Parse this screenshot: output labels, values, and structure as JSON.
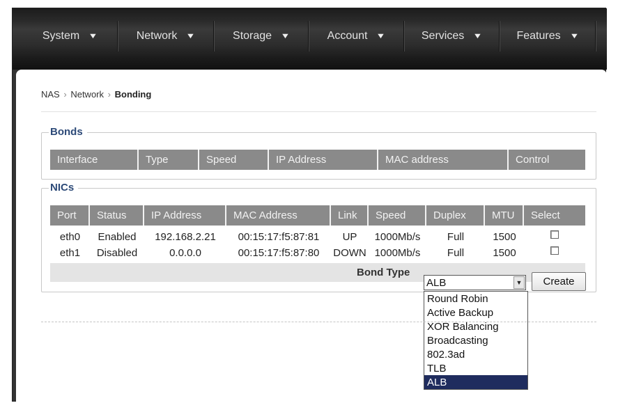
{
  "nav": [
    {
      "label": "System"
    },
    {
      "label": "Network"
    },
    {
      "label": "Storage"
    },
    {
      "label": "Account"
    },
    {
      "label": "Services"
    },
    {
      "label": "Features"
    }
  ],
  "breadcrumb": {
    "root": "NAS",
    "parent": "Network",
    "current": "Bonding",
    "separator": "›"
  },
  "bonds": {
    "legend": "Bonds",
    "headers": [
      "Interface",
      "Type",
      "Speed",
      "IP Address",
      "MAC address",
      "Control"
    ]
  },
  "nics": {
    "legend": "NICs",
    "headers": [
      "Port",
      "Status",
      "IP Address",
      "MAC Address",
      "Link",
      "Speed",
      "Duplex",
      "MTU",
      "Select"
    ],
    "rows": [
      {
        "port": "eth0",
        "status": "Enabled",
        "ip": "192.168.2.21",
        "mac": "00:15:17:f5:87:81",
        "link": "UP",
        "speed": "1000Mb/s",
        "duplex": "Full",
        "mtu": "1500"
      },
      {
        "port": "eth1",
        "status": "Disabled",
        "ip": "0.0.0.0",
        "mac": "00:15:17:f5:87:80",
        "link": "DOWN",
        "speed": "1000Mb/s",
        "duplex": "Full",
        "mtu": "1500"
      }
    ]
  },
  "bond_type": {
    "label": "Bond Type",
    "selected": "ALB",
    "options": [
      "Round Robin",
      "Active Backup",
      "XOR Balancing",
      "Broadcasting",
      "802.3ad",
      "TLB",
      "ALB"
    ],
    "create_label": "Create"
  },
  "icons": {
    "nav_dropdown": "chevron-down-icon",
    "select_arrow": "triangle-down-icon"
  },
  "colors": {
    "nav_bg": "#2d2d2d",
    "header_bg": "#8a8a8a",
    "legend": "#2d4a78",
    "selected_option": "#1f2c5e"
  }
}
